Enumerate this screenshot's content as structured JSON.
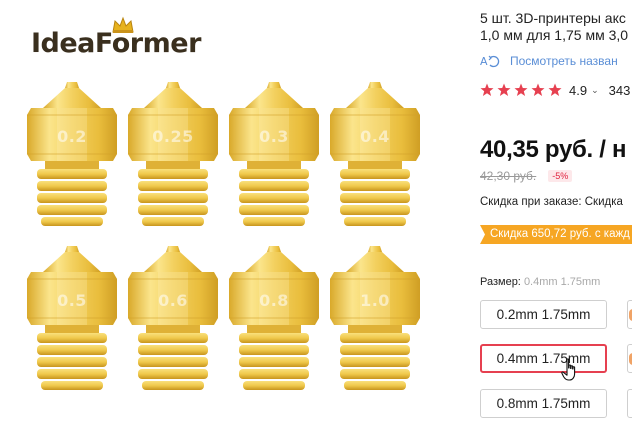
{
  "product_image": {
    "logo": {
      "text_part1": "Idea",
      "text_part2": "Former",
      "crown_icon": "crown-icon"
    },
    "nozzles": [
      {
        "label": "0.2"
      },
      {
        "label": "0.25"
      },
      {
        "label": "0.3"
      },
      {
        "label": "0.4"
      },
      {
        "label": "0.5"
      },
      {
        "label": "0.6"
      },
      {
        "label": "0.8"
      },
      {
        "label": "1.0"
      }
    ],
    "colors": {
      "brass_light": "#fbe48a",
      "brass_mid": "#f2cf55",
      "brass_dark": "#d8a923"
    }
  },
  "product": {
    "title_line1": "5 шт. 3D-принтеры акс",
    "title_line2": "1,0 мм для 1,75 мм 3,0",
    "translate_link": "Посмотреть назван",
    "translate_icon": "translate-icon",
    "rating": {
      "stars": 5,
      "value": "4.9",
      "reviews": "343"
    },
    "price": "40,35 руб. / н",
    "old_price": "42,30 руб.",
    "discount_badge": "-5%",
    "order_discount": "Скидка при заказе: Скидка",
    "discount_banner": "Скидка 650,72 руб. с кажд"
  },
  "size_selector": {
    "label": "Размер:",
    "selected_value": "0.4mm 1.75mm",
    "options": [
      {
        "label": "0.2mm 1.75mm",
        "selected": false
      },
      {
        "label": "0.4mm 1.75mm",
        "selected": true
      },
      {
        "label": "0.8mm 1.75mm",
        "selected": false
      }
    ]
  },
  "colors": {
    "accent_red": "#e64050",
    "star_red": "#e64050",
    "link_blue": "#5a8ed6",
    "banner_orange": "#f6a623",
    "old_price_gray": "#999999"
  }
}
